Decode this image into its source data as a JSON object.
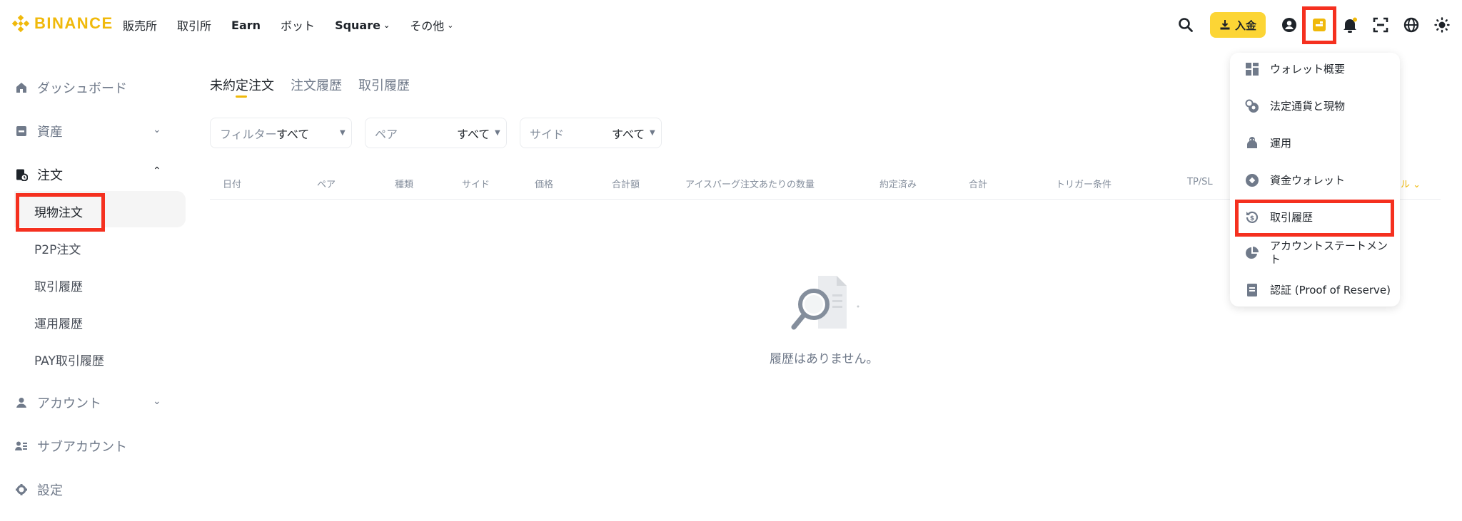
{
  "brand": {
    "name": "BINANCE",
    "color": "#f0b90b"
  },
  "nav": {
    "items": [
      {
        "label": "販売所"
      },
      {
        "label": "取引所"
      },
      {
        "label": "Earn"
      },
      {
        "label": "ボット"
      },
      {
        "label": "Square",
        "has_caret": true
      },
      {
        "label": "その他",
        "has_caret": true
      }
    ]
  },
  "header": {
    "deposit_label": "入金",
    "icons": [
      "search-icon",
      "download-icon",
      "account-icon",
      "wallet-icon",
      "bell-icon",
      "scan-icon",
      "globe-icon",
      "theme-icon"
    ]
  },
  "sidebar": {
    "items": [
      {
        "label": "ダッシュボード",
        "icon": "home-icon"
      },
      {
        "label": "資産",
        "icon": "wallet-icon",
        "expandable": true
      },
      {
        "label": "注文",
        "icon": "order-icon",
        "expanded": true
      },
      {
        "label": "アカウント",
        "icon": "user-icon",
        "expandable": true
      },
      {
        "label": "サブアカウント",
        "icon": "subaccount-icon"
      },
      {
        "label": "設定",
        "icon": "gear-icon"
      }
    ],
    "sub_items": [
      {
        "label": "現物注文",
        "active": true
      },
      {
        "label": "P2P注文"
      },
      {
        "label": "取引履歴"
      },
      {
        "label": "運用履歴"
      },
      {
        "label": "PAY取引履歴"
      }
    ]
  },
  "main": {
    "tabs": [
      {
        "label": "未約定注文",
        "active": true
      },
      {
        "label": "注文履歴"
      },
      {
        "label": "取引履歴"
      }
    ],
    "filters": [
      {
        "label": "フィルター",
        "value": "すべて"
      },
      {
        "label": "ペア",
        "value": "すべて"
      },
      {
        "label": "サイド",
        "value": "すべて"
      }
    ],
    "table": {
      "columns": [
        "日付",
        "ペア",
        "種類",
        "サイド",
        "価格",
        "合計額",
        "アイスバーグ注文あたりの数量",
        "約定済み",
        "合計",
        "トリガー条件",
        "TP/SL"
      ],
      "cancel_partial": "ル"
    },
    "empty_text": "履歴はありません。"
  },
  "wallet_menu": {
    "items": [
      {
        "label": "ウォレット概要",
        "icon": "grid-icon"
      },
      {
        "label": "法定通貨と現物",
        "icon": "fiat-spot-icon"
      },
      {
        "label": "運用",
        "icon": "piggy-icon"
      },
      {
        "label": "資金ウォレット",
        "icon": "funding-icon"
      },
      {
        "label": "取引履歴",
        "icon": "history-icon",
        "highlighted": true
      },
      {
        "label": "アカウントステートメント",
        "icon": "pie-icon"
      },
      {
        "label": "認証 (Proof of Reserve)",
        "icon": "document-icon"
      }
    ]
  },
  "colors": {
    "accent": "#f0b90b",
    "button": "#fcd535",
    "highlight": "#f5301f"
  }
}
